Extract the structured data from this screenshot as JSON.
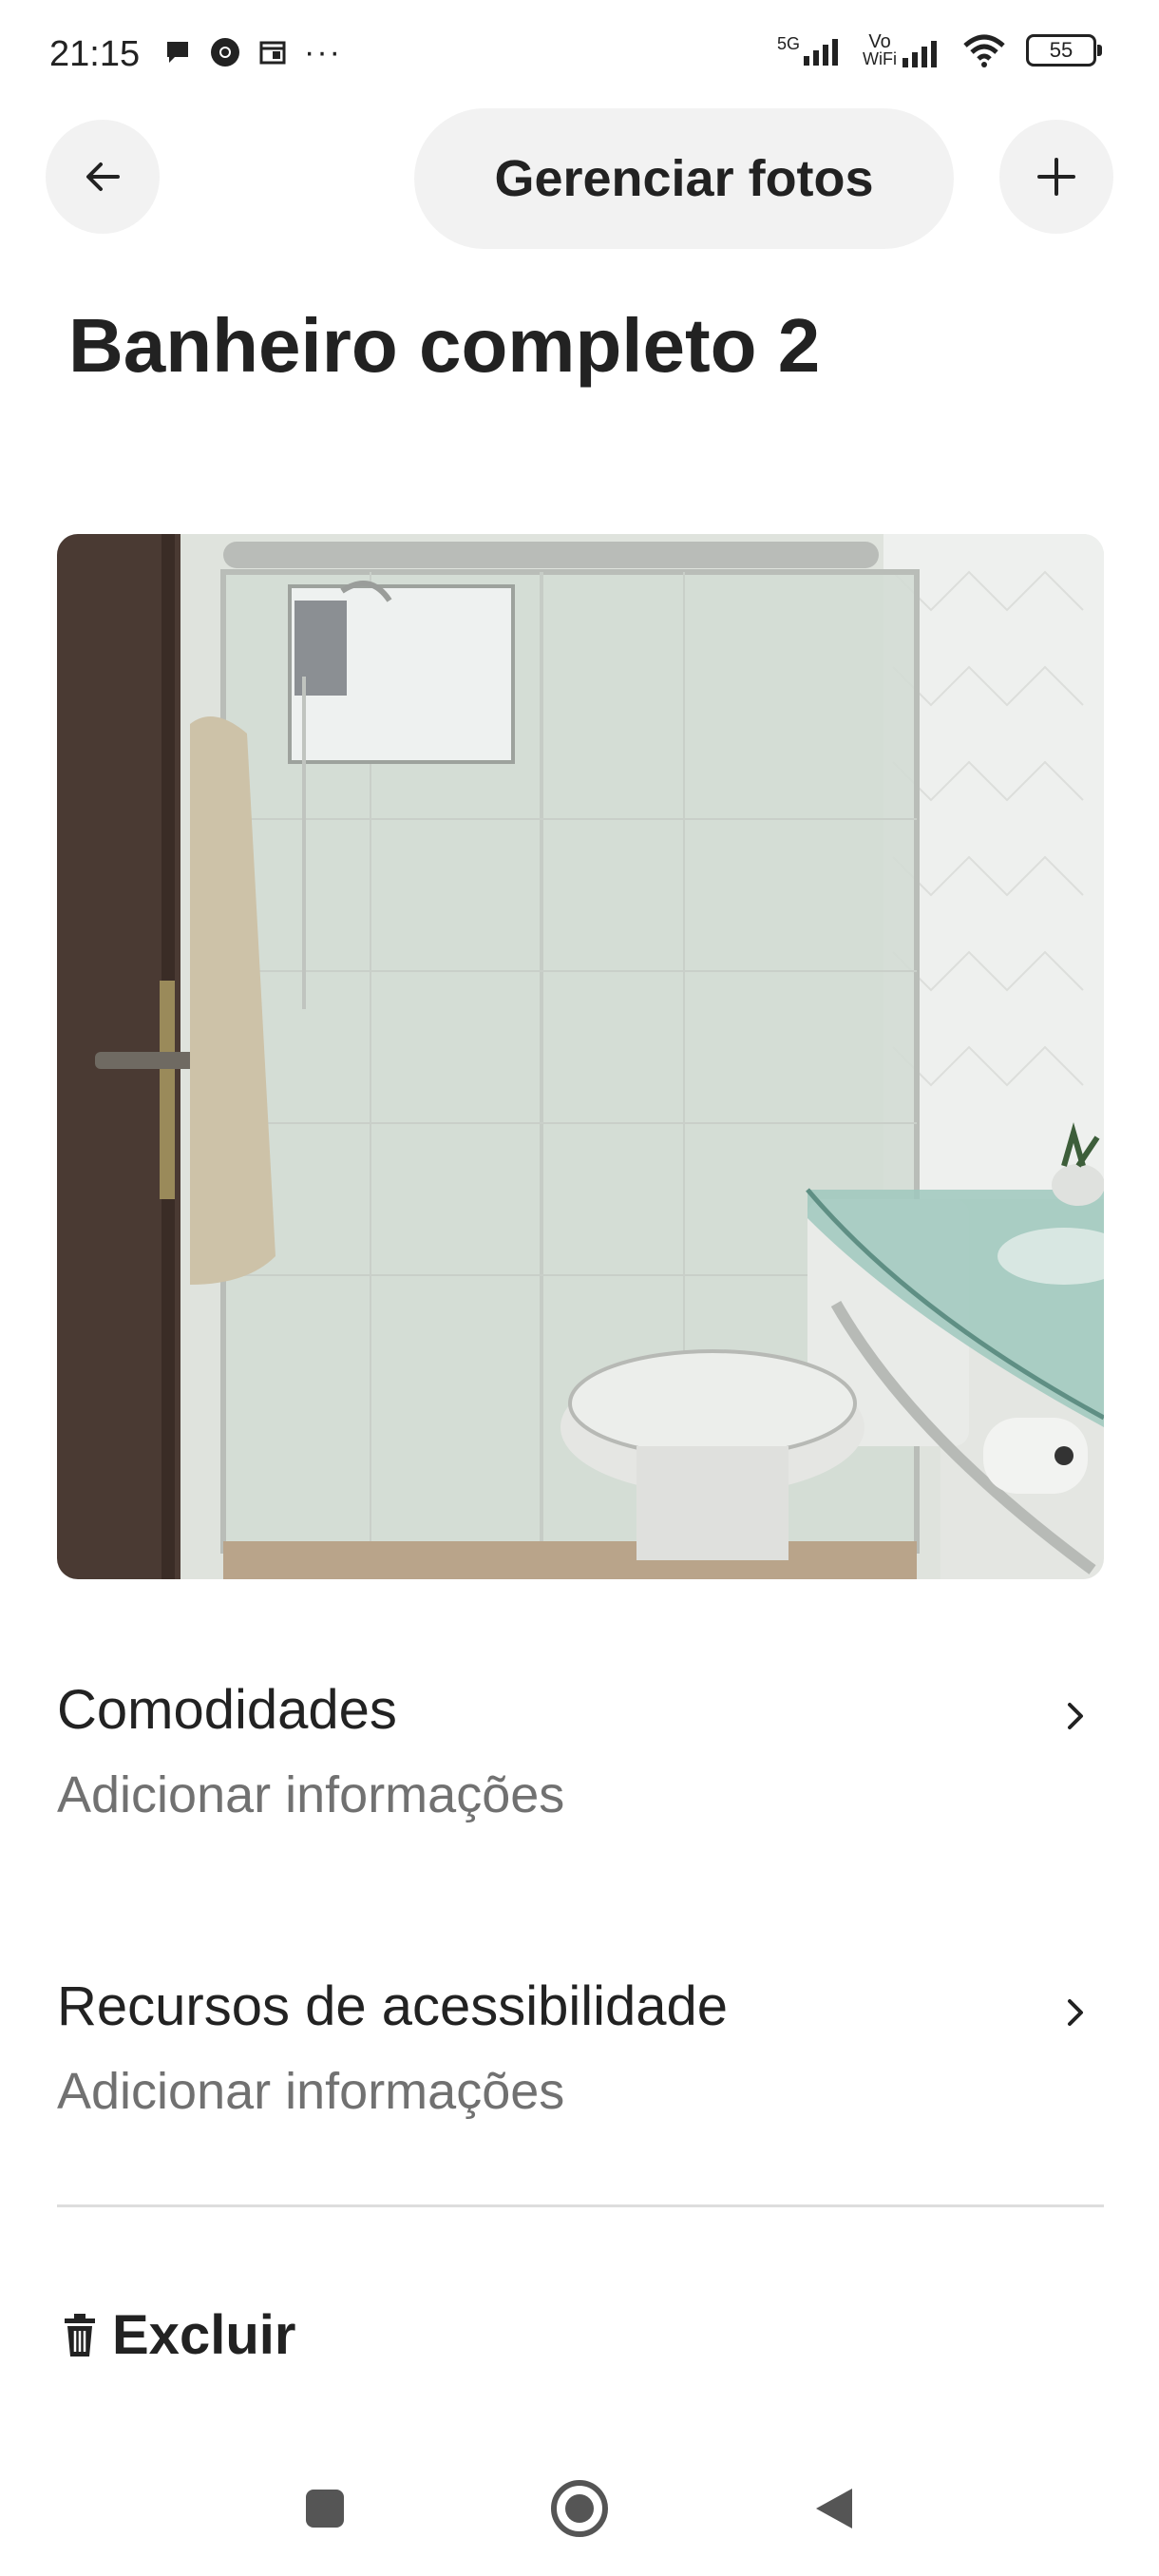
{
  "status_bar": {
    "time": "21:15",
    "network_label": "5G",
    "vowifi_label_top": "Vo",
    "vowifi_label_bottom": "WiFi",
    "battery": "55",
    "more_indicator": "···"
  },
  "header": {
    "title_pill": "Gerenciar fotos",
    "back_icon": "arrow-left-icon",
    "add_icon": "plus-icon"
  },
  "page": {
    "title": "Banheiro completo 2",
    "photo_alt": "Banheiro com box de vidro, vaso sanitário e pia de vidro"
  },
  "sections": [
    {
      "title": "Comodidades",
      "subtitle": "Adicionar informações"
    },
    {
      "title": "Recursos de acessibilidade",
      "subtitle": "Adicionar informações"
    }
  ],
  "delete": {
    "label": "Excluir",
    "icon": "trash-icon"
  },
  "colors": {
    "text": "#222222",
    "secondary": "#717171",
    "pill_bg": "#f2f2f2",
    "divider": "#dddddd"
  }
}
